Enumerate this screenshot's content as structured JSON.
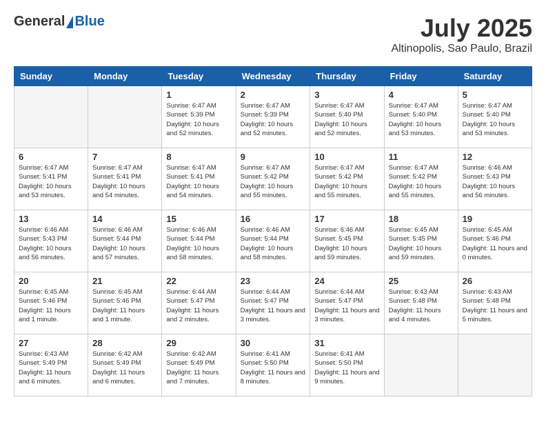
{
  "header": {
    "logo": {
      "general": "General",
      "blue": "Blue"
    },
    "title": "July 2025",
    "subtitle": "Altinopolis, Sao Paulo, Brazil"
  },
  "weekdays": [
    "Sunday",
    "Monday",
    "Tuesday",
    "Wednesday",
    "Thursday",
    "Friday",
    "Saturday"
  ],
  "weeks": [
    [
      {
        "day": null
      },
      {
        "day": null
      },
      {
        "day": 1,
        "sunrise": "6:47 AM",
        "sunset": "5:39 PM",
        "daylight": "10 hours and 52 minutes."
      },
      {
        "day": 2,
        "sunrise": "6:47 AM",
        "sunset": "5:39 PM",
        "daylight": "10 hours and 52 minutes."
      },
      {
        "day": 3,
        "sunrise": "6:47 AM",
        "sunset": "5:40 PM",
        "daylight": "10 hours and 52 minutes."
      },
      {
        "day": 4,
        "sunrise": "6:47 AM",
        "sunset": "5:40 PM",
        "daylight": "10 hours and 53 minutes."
      },
      {
        "day": 5,
        "sunrise": "6:47 AM",
        "sunset": "5:40 PM",
        "daylight": "10 hours and 53 minutes."
      }
    ],
    [
      {
        "day": 6,
        "sunrise": "6:47 AM",
        "sunset": "5:41 PM",
        "daylight": "10 hours and 53 minutes."
      },
      {
        "day": 7,
        "sunrise": "6:47 AM",
        "sunset": "5:41 PM",
        "daylight": "10 hours and 54 minutes."
      },
      {
        "day": 8,
        "sunrise": "6:47 AM",
        "sunset": "5:41 PM",
        "daylight": "10 hours and 54 minutes."
      },
      {
        "day": 9,
        "sunrise": "6:47 AM",
        "sunset": "5:42 PM",
        "daylight": "10 hours and 55 minutes."
      },
      {
        "day": 10,
        "sunrise": "6:47 AM",
        "sunset": "5:42 PM",
        "daylight": "10 hours and 55 minutes."
      },
      {
        "day": 11,
        "sunrise": "6:47 AM",
        "sunset": "5:42 PM",
        "daylight": "10 hours and 55 minutes."
      },
      {
        "day": 12,
        "sunrise": "6:46 AM",
        "sunset": "5:43 PM",
        "daylight": "10 hours and 56 minutes."
      }
    ],
    [
      {
        "day": 13,
        "sunrise": "6:46 AM",
        "sunset": "5:43 PM",
        "daylight": "10 hours and 56 minutes."
      },
      {
        "day": 14,
        "sunrise": "6:46 AM",
        "sunset": "5:44 PM",
        "daylight": "10 hours and 57 minutes."
      },
      {
        "day": 15,
        "sunrise": "6:46 AM",
        "sunset": "5:44 PM",
        "daylight": "10 hours and 58 minutes."
      },
      {
        "day": 16,
        "sunrise": "6:46 AM",
        "sunset": "5:44 PM",
        "daylight": "10 hours and 58 minutes."
      },
      {
        "day": 17,
        "sunrise": "6:46 AM",
        "sunset": "5:45 PM",
        "daylight": "10 hours and 59 minutes."
      },
      {
        "day": 18,
        "sunrise": "6:45 AM",
        "sunset": "5:45 PM",
        "daylight": "10 hours and 59 minutes."
      },
      {
        "day": 19,
        "sunrise": "6:45 AM",
        "sunset": "5:46 PM",
        "daylight": "11 hours and 0 minutes."
      }
    ],
    [
      {
        "day": 20,
        "sunrise": "6:45 AM",
        "sunset": "5:46 PM",
        "daylight": "11 hours and 1 minute."
      },
      {
        "day": 21,
        "sunrise": "6:45 AM",
        "sunset": "5:46 PM",
        "daylight": "11 hours and 1 minute."
      },
      {
        "day": 22,
        "sunrise": "6:44 AM",
        "sunset": "5:47 PM",
        "daylight": "11 hours and 2 minutes."
      },
      {
        "day": 23,
        "sunrise": "6:44 AM",
        "sunset": "5:47 PM",
        "daylight": "11 hours and 3 minutes."
      },
      {
        "day": 24,
        "sunrise": "6:44 AM",
        "sunset": "5:47 PM",
        "daylight": "11 hours and 3 minutes."
      },
      {
        "day": 25,
        "sunrise": "6:43 AM",
        "sunset": "5:48 PM",
        "daylight": "11 hours and 4 minutes."
      },
      {
        "day": 26,
        "sunrise": "6:43 AM",
        "sunset": "5:48 PM",
        "daylight": "11 hours and 5 minutes."
      }
    ],
    [
      {
        "day": 27,
        "sunrise": "6:43 AM",
        "sunset": "5:49 PM",
        "daylight": "11 hours and 6 minutes."
      },
      {
        "day": 28,
        "sunrise": "6:42 AM",
        "sunset": "5:49 PM",
        "daylight": "11 hours and 6 minutes."
      },
      {
        "day": 29,
        "sunrise": "6:42 AM",
        "sunset": "5:49 PM",
        "daylight": "11 hours and 7 minutes."
      },
      {
        "day": 30,
        "sunrise": "6:41 AM",
        "sunset": "5:50 PM",
        "daylight": "11 hours and 8 minutes."
      },
      {
        "day": 31,
        "sunrise": "6:41 AM",
        "sunset": "5:50 PM",
        "daylight": "11 hours and 9 minutes."
      },
      {
        "day": null
      },
      {
        "day": null
      }
    ]
  ]
}
